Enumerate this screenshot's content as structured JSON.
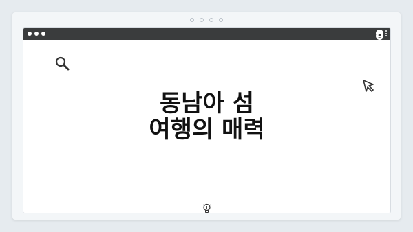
{
  "pager": {
    "count": 4
  },
  "window": {
    "controls": [
      "dot",
      "dot",
      "dot"
    ],
    "toolbar_icons": [
      "avatar-icon",
      "more-icon"
    ]
  },
  "content": {
    "headline_line1": "동남아 섬",
    "headline_line2": "여행의 매력",
    "icons": [
      "search-icon",
      "cursor-icon",
      "lightbulb-icon"
    ]
  },
  "colors": {
    "background": "#e6ebef",
    "card": "#f3f6f8",
    "window": "#ffffff",
    "titlebar": "#3a3c3d",
    "text": "#111111"
  }
}
